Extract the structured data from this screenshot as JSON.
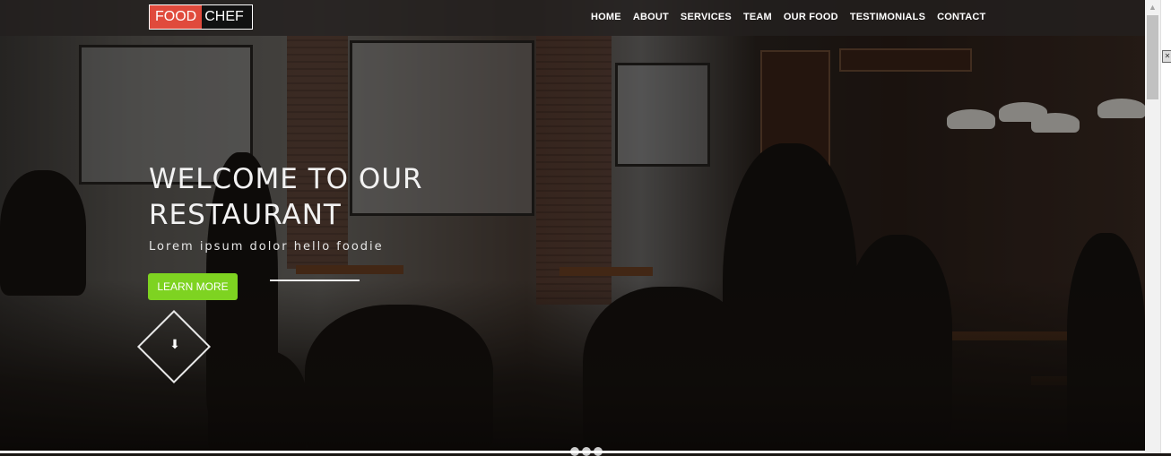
{
  "logo": {
    "part1": "FOOD",
    "part2": "CHEF"
  },
  "nav": {
    "items": [
      {
        "label": "HOME"
      },
      {
        "label": "ABOUT"
      },
      {
        "label": "SERVICES"
      },
      {
        "label": "TEAM"
      },
      {
        "label": "OUR FOOD"
      },
      {
        "label": "TESTIMONIALS"
      },
      {
        "label": "CONTACT"
      }
    ]
  },
  "hero": {
    "title_line1": "WELCOME TO OUR",
    "title_line2": "RESTAURANT",
    "tagline": "Lorem ipsum dolor hello foodie",
    "cta_label": "LEARN MORE",
    "scroll_icon": "arrow-down-icon",
    "scroll_glyph": "⬇"
  },
  "slider": {
    "dot_count": 3,
    "active_index": 0
  },
  "colors": {
    "accent_red": "#e04a3c",
    "cta_green": "#7ed321",
    "navbar_bg": "#23201e"
  }
}
